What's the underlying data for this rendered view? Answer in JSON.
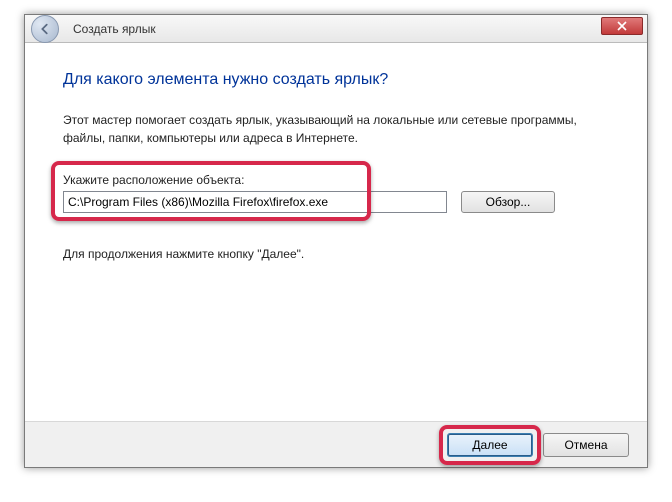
{
  "window": {
    "title": "Создать ярлык"
  },
  "heading": "Для какого элемента нужно создать ярлык?",
  "description": "Этот мастер помогает создать ярлык, указывающий на локальные или сетевые программы, файлы, папки, компьютеры или адреса в Интернете.",
  "input": {
    "label": "Укажите расположение объекта:",
    "value": "C:\\Program Files (x86)\\Mozilla Firefox\\firefox.exe"
  },
  "browse_label": "Обзор...",
  "continue_hint": "Для продолжения нажмите кнопку \"Далее\".",
  "buttons": {
    "next": "Далее",
    "cancel": "Отмена"
  }
}
